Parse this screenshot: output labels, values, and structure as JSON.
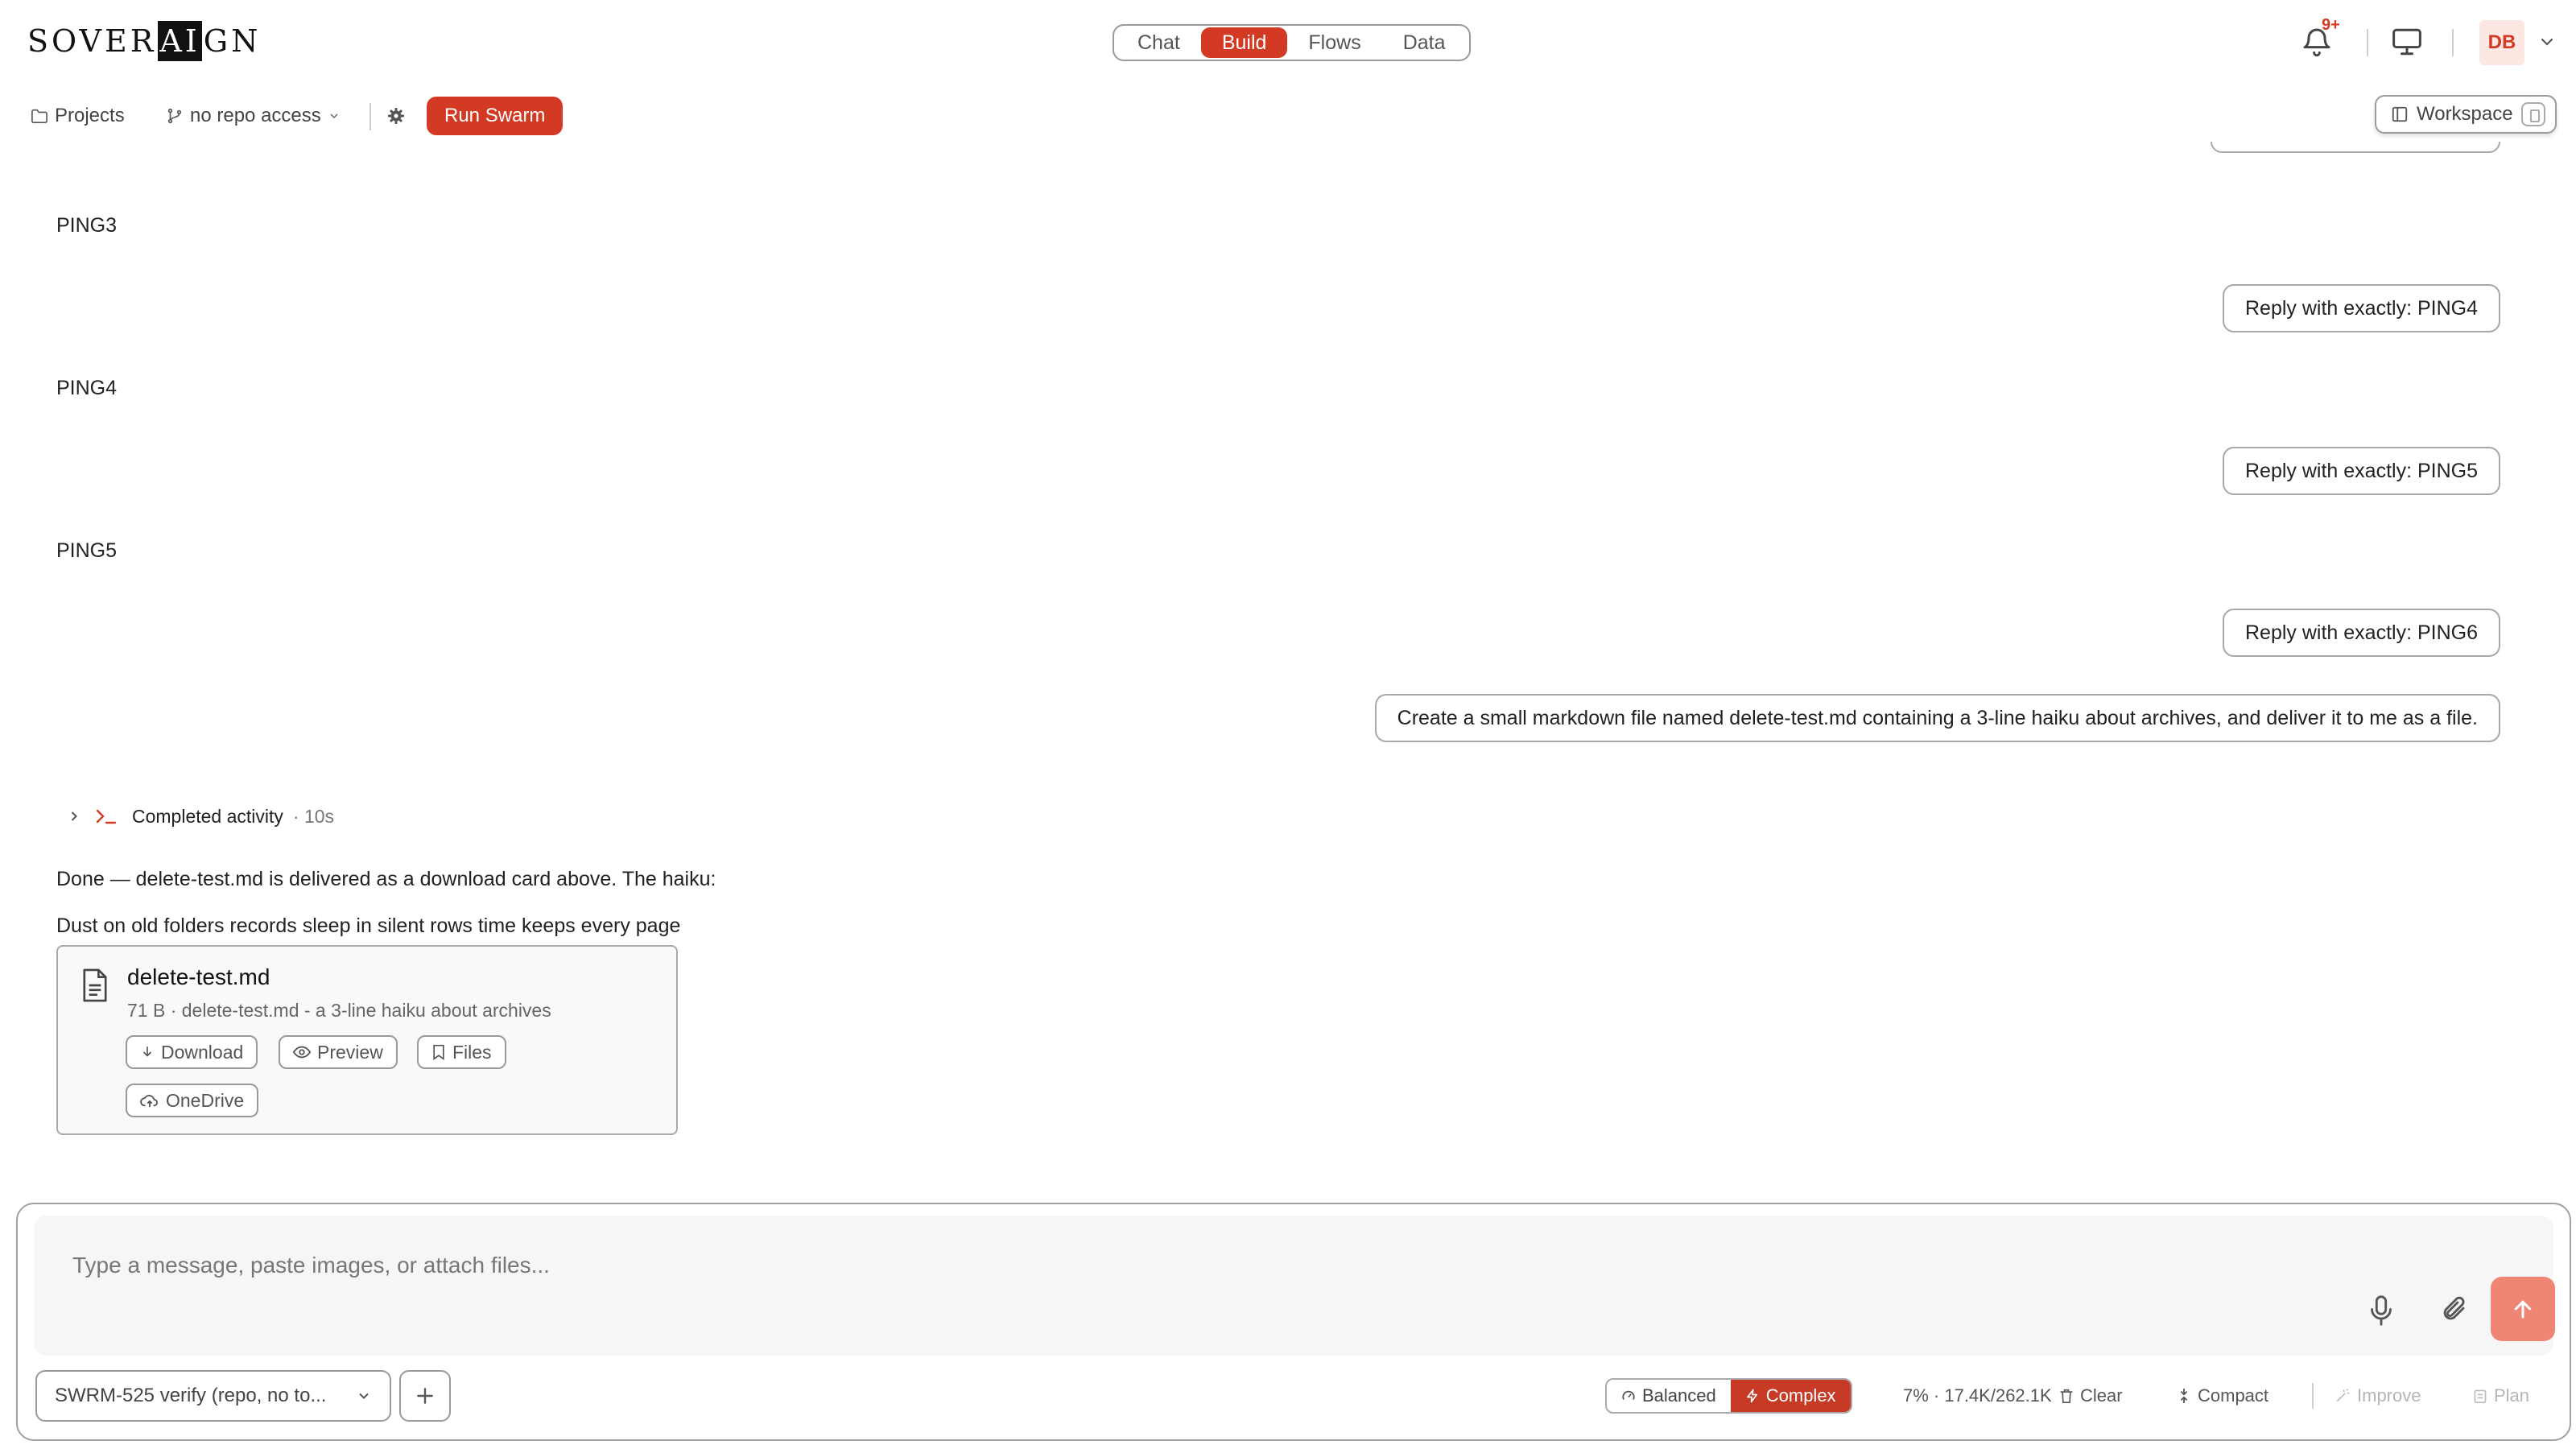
{
  "header": {
    "logo": {
      "pre": "SOVER",
      "mark": "AI",
      "post": "GN"
    },
    "tabs": [
      {
        "label": "Chat",
        "active": false
      },
      {
        "label": "Build",
        "active": true
      },
      {
        "label": "Flows",
        "active": false
      },
      {
        "label": "Data",
        "active": false
      }
    ],
    "notifications_badge": "9+",
    "avatar_initials": "DB"
  },
  "toolbar": {
    "projects_label": "Projects",
    "repo_label": "no repo access",
    "run_swarm_label": "Run Swarm",
    "workspace_label": "Workspace"
  },
  "chat": {
    "messages": [
      {
        "role": "assistant",
        "text": "PING3"
      },
      {
        "role": "user",
        "text": "Reply with exactly: PING4"
      },
      {
        "role": "assistant",
        "text": "PING4"
      },
      {
        "role": "user",
        "text": "Reply with exactly: PING5"
      },
      {
        "role": "assistant",
        "text": "PING5"
      },
      {
        "role": "user",
        "text": "Reply with exactly: PING6"
      },
      {
        "role": "user",
        "text": "Create a small markdown file named delete-test.md containing a 3-line haiku about archives, and deliver it to me as a file."
      }
    ],
    "activity": {
      "label": "Completed activity",
      "duration": "· 10s"
    },
    "final_reply": {
      "line1": "Done — delete-test.md is delivered as a download card above. The haiku:",
      "line2": "Dust on old folders records sleep in silent rows time keeps every page"
    },
    "file_card": {
      "name": "delete-test.md",
      "meta": "71 B · delete-test.md - a 3-line haiku about archives",
      "buttons": {
        "download": "Download",
        "preview": "Preview",
        "files": "Files",
        "onedrive": "OneDrive"
      }
    }
  },
  "composer": {
    "placeholder": "Type a message, paste images, or attach files...",
    "project_select": "SWRM-525 verify (repo, no to...",
    "modes": [
      {
        "label": "Balanced",
        "active": false
      },
      {
        "label": "Complex",
        "active": true
      }
    ],
    "context_usage": "7% · 17.4K/262.1K",
    "clear_label": "Clear",
    "compact_label": "Compact",
    "improve_label": "Improve",
    "plan_label": "Plan"
  },
  "colors": {
    "accent": "#d33a24",
    "send_button": "#ef8575"
  }
}
